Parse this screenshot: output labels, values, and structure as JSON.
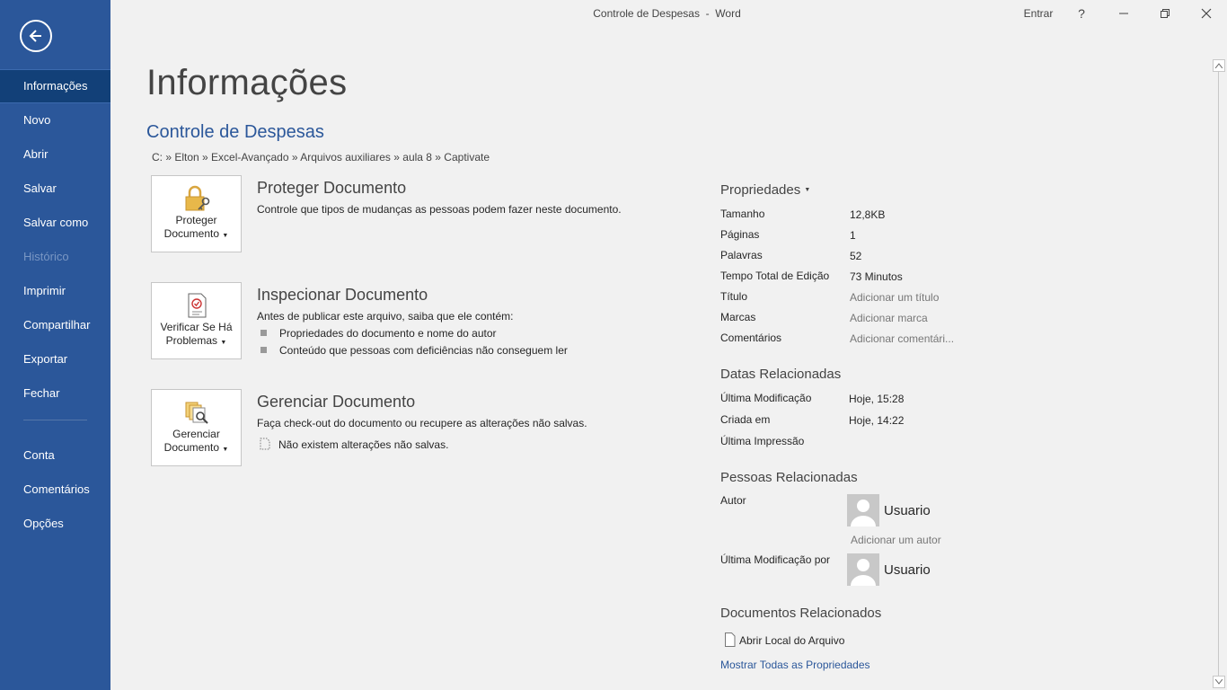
{
  "window": {
    "title": "Controle de Despesas  -  Word",
    "signin": "Entrar",
    "help": "?"
  },
  "sidebar": {
    "items": [
      {
        "label": "Informações",
        "active": true
      },
      {
        "label": "Novo"
      },
      {
        "label": "Abrir"
      },
      {
        "label": "Salvar"
      },
      {
        "label": "Salvar como"
      },
      {
        "label": "Histórico",
        "disabled": true
      },
      {
        "label": "Imprimir"
      },
      {
        "label": "Compartilhar"
      },
      {
        "label": "Exportar"
      },
      {
        "label": "Fechar"
      }
    ],
    "lower_items": [
      {
        "label": "Conta"
      },
      {
        "label": "Comentários"
      },
      {
        "label": "Opções"
      }
    ]
  },
  "main": {
    "page_title": "Informações",
    "doc_name": "Controle de Despesas",
    "breadcrumb": "C: » Elton » Excel-Avançado » Arquivos auxiliares » aula 8 » Captivate",
    "sections": [
      {
        "tile_line1": "Proteger",
        "tile_line2": "Documento",
        "title": "Proteger Documento",
        "desc": "Controle que tipos de mudanças as pessoas podem fazer neste documento."
      },
      {
        "tile_line1": "Verificar Se Há",
        "tile_line2": "Problemas",
        "title": "Inspecionar Documento",
        "desc": "Antes de publicar este arquivo, saiba que ele contém:",
        "bullets": [
          "Propriedades do documento e nome do autor",
          "Conteúdo que pessoas com deficiências não conseguem ler"
        ]
      },
      {
        "tile_line1": "Gerenciar",
        "tile_line2": "Documento",
        "title": "Gerenciar Documento",
        "desc": "Faça check-out do documento ou recupere as alterações não salvas.",
        "note": "Não existem alterações não salvas."
      }
    ]
  },
  "properties": {
    "heading": "Propriedades",
    "rows": [
      {
        "label": "Tamanho",
        "value": "12,8KB"
      },
      {
        "label": "Páginas",
        "value": "1"
      },
      {
        "label": "Palavras",
        "value": "52"
      },
      {
        "label": "Tempo Total de Edição",
        "value": "73 Minutos"
      },
      {
        "label": "Título",
        "value": "Adicionar um título"
      },
      {
        "label": "Marcas",
        "value": "Adicionar marca"
      },
      {
        "label": "Comentários",
        "value": "Adicionar comentári..."
      }
    ],
    "dates_heading": "Datas Relacionadas",
    "dates": [
      {
        "label": "Última Modificação",
        "value": "Hoje, 15:28"
      },
      {
        "label": "Criada em",
        "value": "Hoje, 14:22"
      },
      {
        "label": "Última Impressão",
        "value": ""
      }
    ],
    "people_heading": "Pessoas Relacionadas",
    "author_label": "Autor",
    "author_name": "Usuario",
    "add_author": "Adicionar um autor",
    "modified_by_label": "Última Modificação por",
    "modified_by_name": "Usuario",
    "docs_heading": "Documentos Relacionados",
    "open_location": "Abrir Local do Arquivo",
    "show_all": "Mostrar Todas as Propriedades"
  },
  "colors": {
    "sidebar": "#2b579a",
    "sidebar_active": "#124078",
    "link": "#2b579a"
  }
}
